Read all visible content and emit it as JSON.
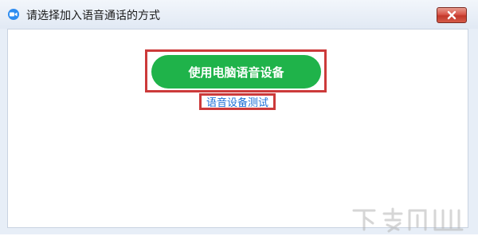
{
  "window": {
    "title": "请选择加入语音通话的方式",
    "icon": "video-camera-icon",
    "close_icon": "close-icon"
  },
  "main": {
    "primary_button_label": "使用电脑语音设备",
    "test_link_label": "语音设备测试"
  },
  "colors": {
    "primary_button": "#1fb34a",
    "link": "#1d6fd6",
    "highlight_border": "#cc3a3a",
    "close_button": "#c3382b"
  }
}
